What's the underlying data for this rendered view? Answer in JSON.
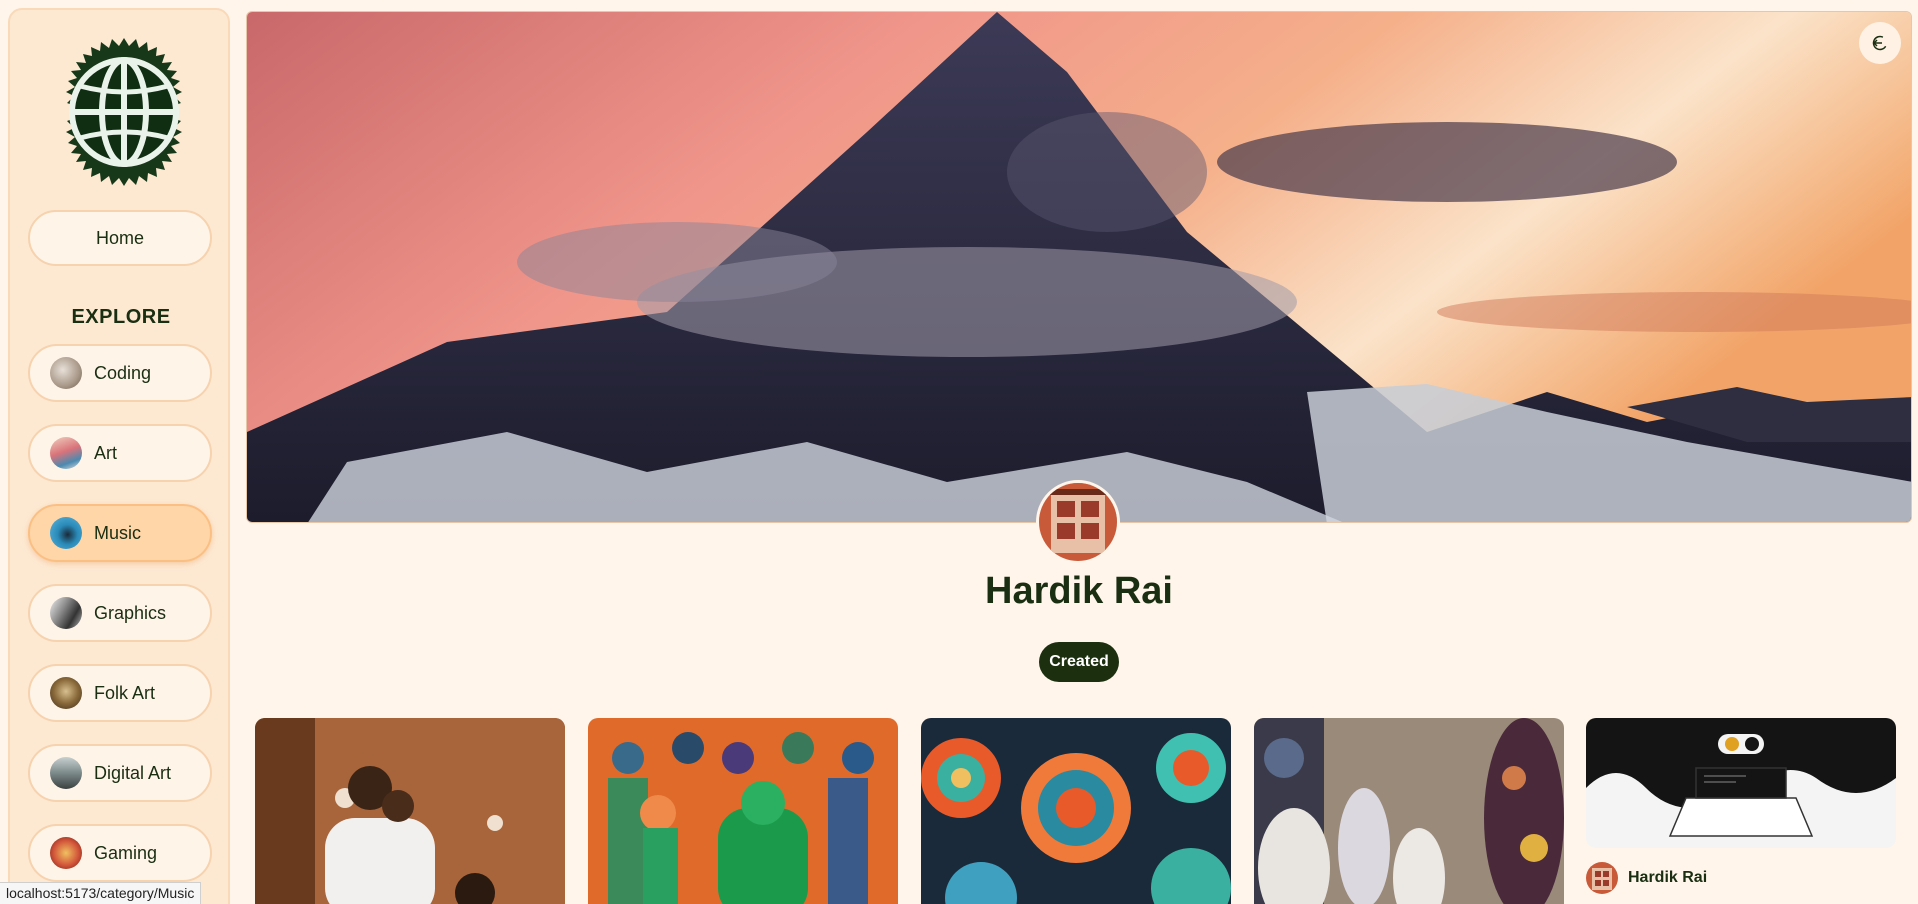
{
  "sidebar": {
    "home_label": "Home",
    "explore_heading": "EXPLORE",
    "categories": [
      {
        "label": "Coding",
        "icon": "coding-thumb-icon",
        "color": "#b8a89a"
      },
      {
        "label": "Art",
        "icon": "art-thumb-icon",
        "color": "#d9737a"
      },
      {
        "label": "Music",
        "icon": "music-thumb-icon",
        "color": "#2a8ab8",
        "active": true
      },
      {
        "label": "Graphics",
        "icon": "graphics-thumb-icon",
        "color": "#777777"
      },
      {
        "label": "Folk Art",
        "icon": "folk-art-thumb-icon",
        "color": "#8a6a3a"
      },
      {
        "label": "Digital Art",
        "icon": "digital-art-thumb-icon",
        "color": "#7d8a8a"
      },
      {
        "label": "Gaming",
        "icon": "gaming-thumb-icon",
        "color": "#d2553a"
      }
    ]
  },
  "profile": {
    "name": "Hardik Rai",
    "tab_created": "Created"
  },
  "pins": [
    {
      "icon": "photo-family-thumb"
    },
    {
      "icon": "anime-characters-thumb"
    },
    {
      "icon": "mandala-pattern-thumb"
    },
    {
      "icon": "pottery-vases-thumb"
    },
    {
      "icon": "laptop-illustration-thumb",
      "user": "Hardik Rai"
    }
  ],
  "status_url": "localhost:5173/category/Music",
  "colors": {
    "accent": "#1c3010",
    "background": "#fff5ea",
    "sidebar": "#fde9d2",
    "active": "#ffd6a8"
  }
}
